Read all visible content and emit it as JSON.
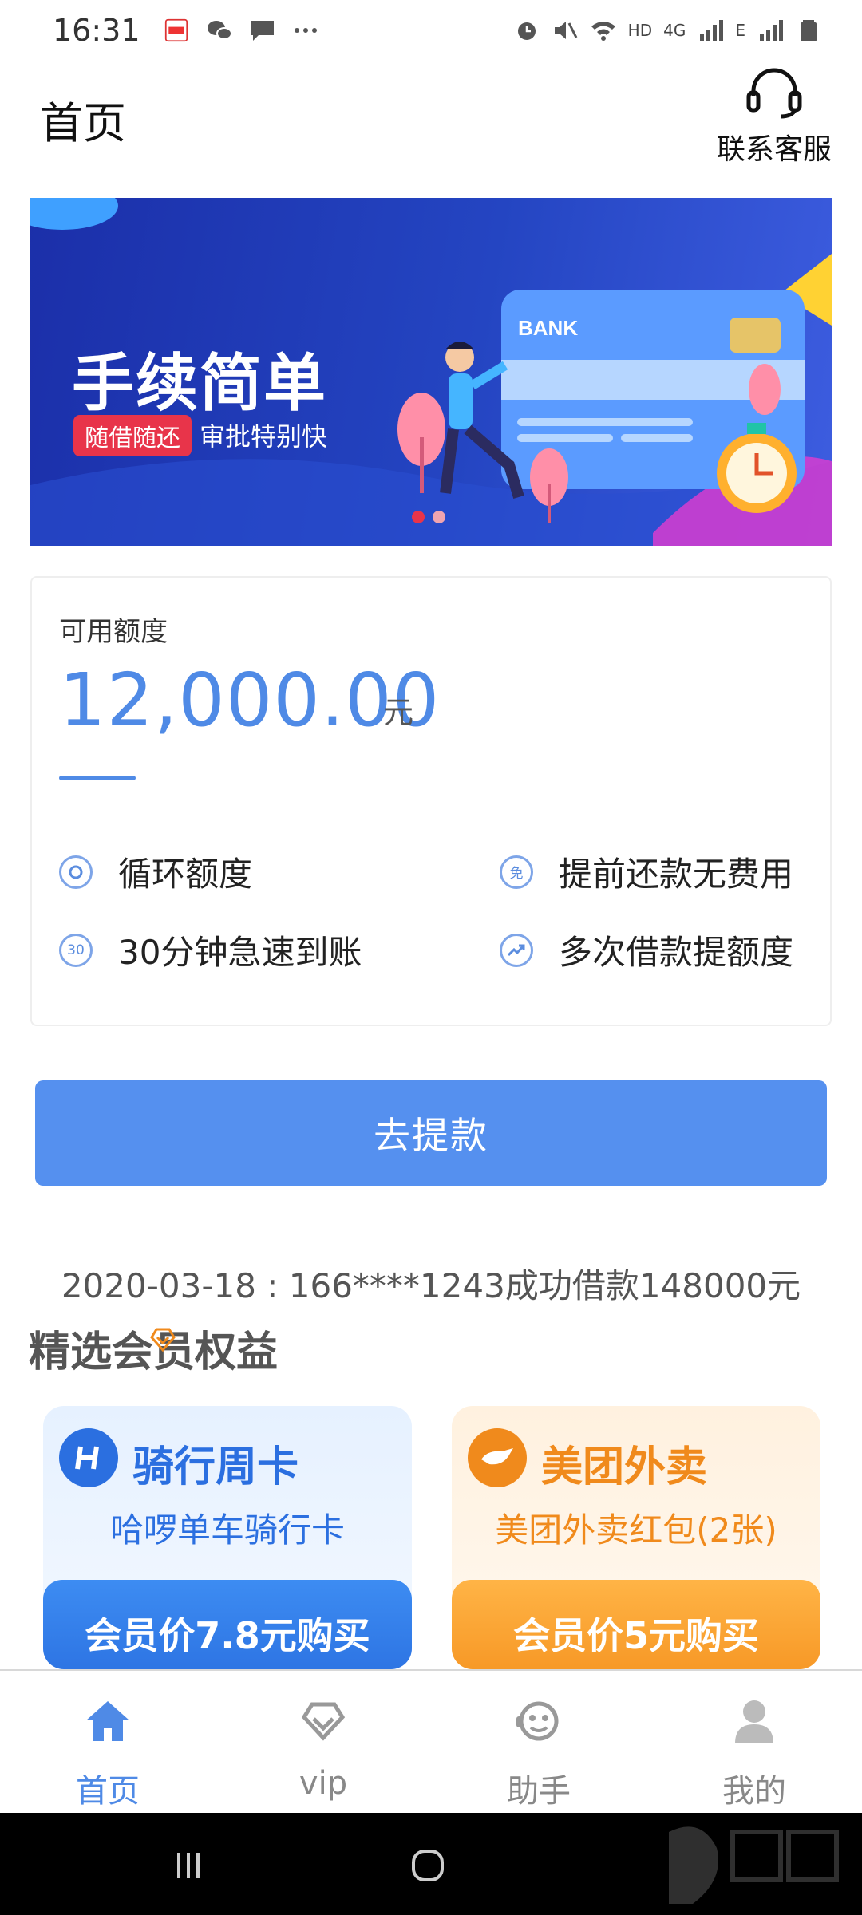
{
  "status_bar": {
    "time": "16:31",
    "network": "HD",
    "network_gen": "4G",
    "network_e": "E"
  },
  "header": {
    "title": "首页",
    "service_label": "联系客服"
  },
  "banner": {
    "title": "手续简单",
    "tag": "随借随还",
    "subtitle": "审批特别快",
    "card_text": "BANK",
    "dots": [
      "#e8344a",
      "#f0a4b0"
    ]
  },
  "credit": {
    "label": "可用额度",
    "amount": "12,000.00",
    "unit": "元",
    "features": [
      {
        "icon_text": "",
        "label": "循环额度"
      },
      {
        "icon_text": "免",
        "label": "提前还款无费用"
      },
      {
        "icon_text": "30",
        "label": "30分钟急速到账"
      },
      {
        "icon_text": "",
        "label": "多次借款提额度"
      }
    ]
  },
  "withdraw_button": "去提款",
  "notice": "2020-03-18 : 166****1243成功借款148000元",
  "benefits": {
    "title": "精选会员权益",
    "cards": [
      {
        "name": "骑行周卡",
        "desc": "哈啰单车骑行卡",
        "buy": "会员价7.8元购买",
        "accent": "#2b6fe0"
      },
      {
        "name": "美团外卖",
        "desc": "美团外卖红包(2张)",
        "buy": "会员价5元购买",
        "accent": "#f08a1c"
      }
    ]
  },
  "tabs": [
    {
      "label": "首页",
      "icon": "home-icon",
      "active": true
    },
    {
      "label": "vip",
      "icon": "vip-diamond-icon",
      "active": false
    },
    {
      "label": "助手",
      "icon": "assistant-icon",
      "active": false
    },
    {
      "label": "我的",
      "icon": "profile-icon",
      "active": false
    }
  ],
  "colors": {
    "primary": "#4f8ae6",
    "button": "#5590ef",
    "banner": "#2445c2"
  }
}
